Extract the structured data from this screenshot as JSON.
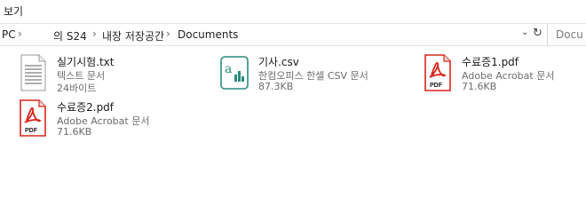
{
  "menu": {
    "view_label": "보기"
  },
  "address": {
    "crumbs": [
      "PC",
      "의 S24",
      "내장 저장공간",
      "Documents"
    ],
    "separator": "›",
    "dropdown_icon": "chevron-down-icon",
    "refresh_icon": "refresh-icon"
  },
  "search": {
    "placeholder": "Docu"
  },
  "files": [
    {
      "name": "실기시험.txt",
      "type": "텍스트 문서",
      "size": "24바이트",
      "icon": "text-file-icon"
    },
    {
      "name": "기사.csv",
      "type": "한컴오피스 한셀 CSV 문서",
      "size": "87.3KB",
      "icon": "csv-file-icon"
    },
    {
      "name": "수료증1.pdf",
      "type": "Adobe Acrobat 문서",
      "size": "71.6KB",
      "icon": "pdf-file-icon"
    },
    {
      "name": "수료증2.pdf",
      "type": "Adobe Acrobat 문서",
      "size": "71.6KB",
      "icon": "pdf-file-icon"
    }
  ],
  "icon_labels": {
    "pdf": "PDF",
    "csv": "a"
  },
  "colors": {
    "pdf_red": "#d7261c",
    "csv_teal": "#2a8c7c",
    "text_gray": "#6d6d6d"
  }
}
